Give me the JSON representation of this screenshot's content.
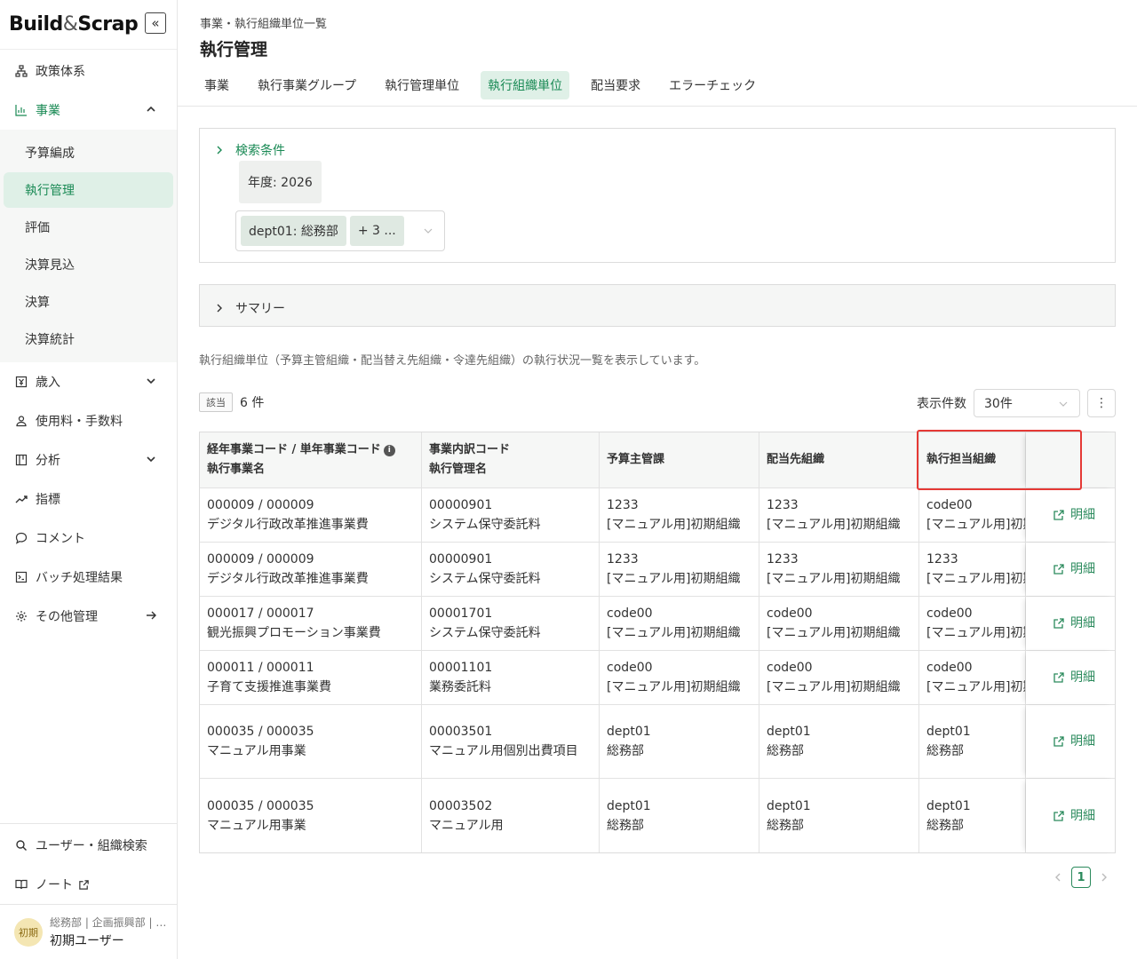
{
  "app": {
    "logo_left": "Build",
    "logo_amp": "&",
    "logo_right": "Scrap",
    "collapse_glyph": "«"
  },
  "sidebar": {
    "items": [
      {
        "label": "政策体系",
        "icon": "sitemap-icon"
      },
      {
        "label": "事業",
        "icon": "bar-chart-icon",
        "expanded": true
      },
      {
        "label": "歳入",
        "icon": "yen-icon"
      },
      {
        "label": "使用料・手数料",
        "icon": "users-icon"
      },
      {
        "label": "分析",
        "icon": "panel-icon"
      },
      {
        "label": "指標",
        "icon": "trend-icon"
      },
      {
        "label": "コメント",
        "icon": "comment-icon"
      },
      {
        "label": "バッチ処理結果",
        "icon": "terminal-icon"
      },
      {
        "label": "その他管理",
        "icon": "gear-icon"
      }
    ],
    "sub_items": [
      "予算編成",
      "執行管理",
      "評価",
      "決算見込",
      "決算",
      "決算統計"
    ],
    "active_sub": "執行管理",
    "bottom": [
      {
        "label": "ユーザー・組織検索",
        "icon": "search-icon"
      },
      {
        "label": "ノート",
        "icon": "book-icon"
      }
    ],
    "user": {
      "avatar_text": "初期",
      "dept": "総務部 | 企画振興部 | …",
      "name": "初期ユーザー"
    }
  },
  "header": {
    "breadcrumb": "事業・執行組織単位一覧",
    "title": "執行管理",
    "tabs": [
      "事業",
      "執行事業グループ",
      "執行管理単位",
      "執行組織単位",
      "配当要求",
      "エラーチェック"
    ],
    "active_tab": "執行組織単位"
  },
  "search": {
    "title": "検索条件",
    "year_chip": "年度: 2026",
    "dept_tag": "dept01: 総務部",
    "more_tag": "+ 3 ..."
  },
  "summary": {
    "title": "サマリー"
  },
  "description": "執行組織単位（予算主管組織・配当替え先組織・令達先組織）の執行状況一覧を表示しています。",
  "results": {
    "hit_label": "該当",
    "count": "6 件",
    "per_page_label": "表示件数",
    "per_page_value": "30件",
    "more_glyph": "⋮"
  },
  "table": {
    "headers": {
      "col1_line1": "経年事業コード / 単年事業コード",
      "col1_line2": "執行事業名",
      "col2_line1": "事業内訳コード",
      "col2_line2": "執行管理名",
      "col3": "予算主管課",
      "col4": "配当先組織",
      "col5": "執行担当組織"
    },
    "detail_label": "明細",
    "rows": [
      {
        "c1a": "000009 / 000009",
        "c1b": "デジタル行政改革推進事業費",
        "c2a": "00000901",
        "c2b": "システム保守委託料",
        "c3a": "1233",
        "c3b": "[マニュアル用]初期組織",
        "c4a": "1233",
        "c4b": "[マニュアル用]初期組織",
        "c5a": "code00",
        "c5b": "[マニュアル用]初期組織"
      },
      {
        "c1a": "000009 / 000009",
        "c1b": "デジタル行政改革推進事業費",
        "c2a": "00000901",
        "c2b": "システム保守委託料",
        "c3a": "1233",
        "c3b": "[マニュアル用]初期組織",
        "c4a": "1233",
        "c4b": "[マニュアル用]初期組織",
        "c5a": "1233",
        "c5b": "[マニュアル用]初期組織"
      },
      {
        "c1a": "000017 / 000017",
        "c1b": "観光振興プロモーション事業費",
        "c2a": "00001701",
        "c2b": "システム保守委託料",
        "c3a": "code00",
        "c3b": "[マニュアル用]初期組織",
        "c4a": "code00",
        "c4b": "[マニュアル用]初期組織",
        "c5a": "code00",
        "c5b": "[マニュアル用]初期組織"
      },
      {
        "c1a": "000011 / 000011",
        "c1b": "子育て支援推進事業費",
        "c2a": "00001101",
        "c2b": "業務委託料",
        "c3a": "code00",
        "c3b": "[マニュアル用]初期組織",
        "c4a": "code00",
        "c4b": "[マニュアル用]初期組織",
        "c5a": "code00",
        "c5b": "[マニュアル用]初期組織"
      },
      {
        "c1a": "000035 / 000035",
        "c1b": "マニュアル用事業",
        "c2a": "00003501",
        "c2b": "マニュアル用個別出費項目",
        "c3a": "dept01",
        "c3b": "総務部",
        "c4a": "dept01",
        "c4b": "総務部",
        "c5a": "dept01",
        "c5b": "総務部"
      },
      {
        "c1a": "000035 / 000035",
        "c1b": "マニュアル用事業",
        "c2a": "00003502",
        "c2b": "マニュアル用",
        "c3a": "dept01",
        "c3b": "総務部",
        "c4a": "dept01",
        "c4b": "総務部",
        "c5a": "dept01",
        "c5b": "総務部"
      }
    ]
  },
  "pagination": {
    "current": "1"
  },
  "colors": {
    "accent": "#1a8a55",
    "accent_bg": "#dff0e7",
    "highlight": "#e53935"
  }
}
